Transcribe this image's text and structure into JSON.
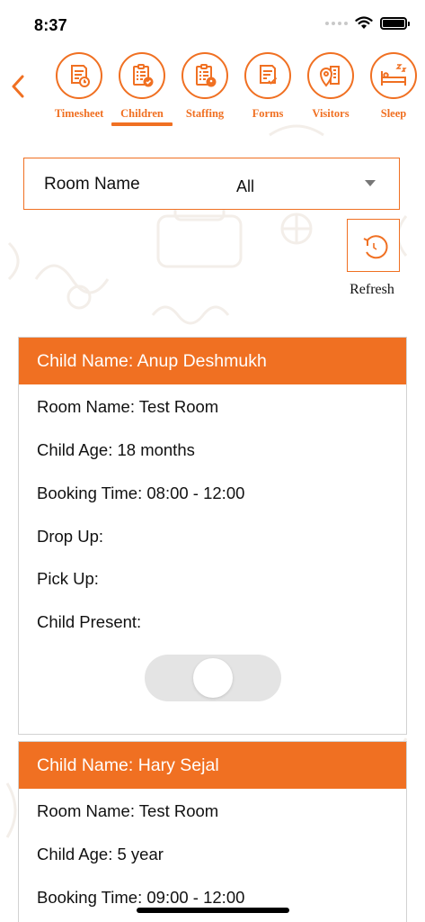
{
  "status_bar": {
    "time": "8:37"
  },
  "tabs": [
    {
      "label": "Timesheet",
      "icon": "timesheet-icon",
      "selected": false
    },
    {
      "label": "Children",
      "icon": "children-icon",
      "selected": true
    },
    {
      "label": "Staffing",
      "icon": "staffing-icon",
      "selected": false
    },
    {
      "label": "Forms",
      "icon": "forms-icon",
      "selected": false
    },
    {
      "label": "Visitors",
      "icon": "visitors-icon",
      "selected": false
    },
    {
      "label": "Sleep",
      "icon": "sleep-icon",
      "selected": false
    }
  ],
  "filter": {
    "room_label": "Room Name",
    "room_value": "All"
  },
  "refresh": {
    "label": "Refresh"
  },
  "children": [
    {
      "title": "Child Name: Anup Deshmukh",
      "room": "Room Name: Test Room",
      "age": "Child Age: 18 months",
      "booking": "Booking Time: 08:00 - 12:00",
      "drop": "Drop Up:",
      "pick": "Pick Up:",
      "present": "Child Present:",
      "present_on": false
    },
    {
      "title": "Child Name: Hary Sejal",
      "room": "Room Name: Test Room",
      "age": "Child Age: 5 year",
      "booking": "Booking Time: 09:00 - 12:00"
    }
  ],
  "colors": {
    "accent": "#f07022",
    "card_border": "#d2d2d2",
    "toggle_off": "#e4e4e4"
  }
}
